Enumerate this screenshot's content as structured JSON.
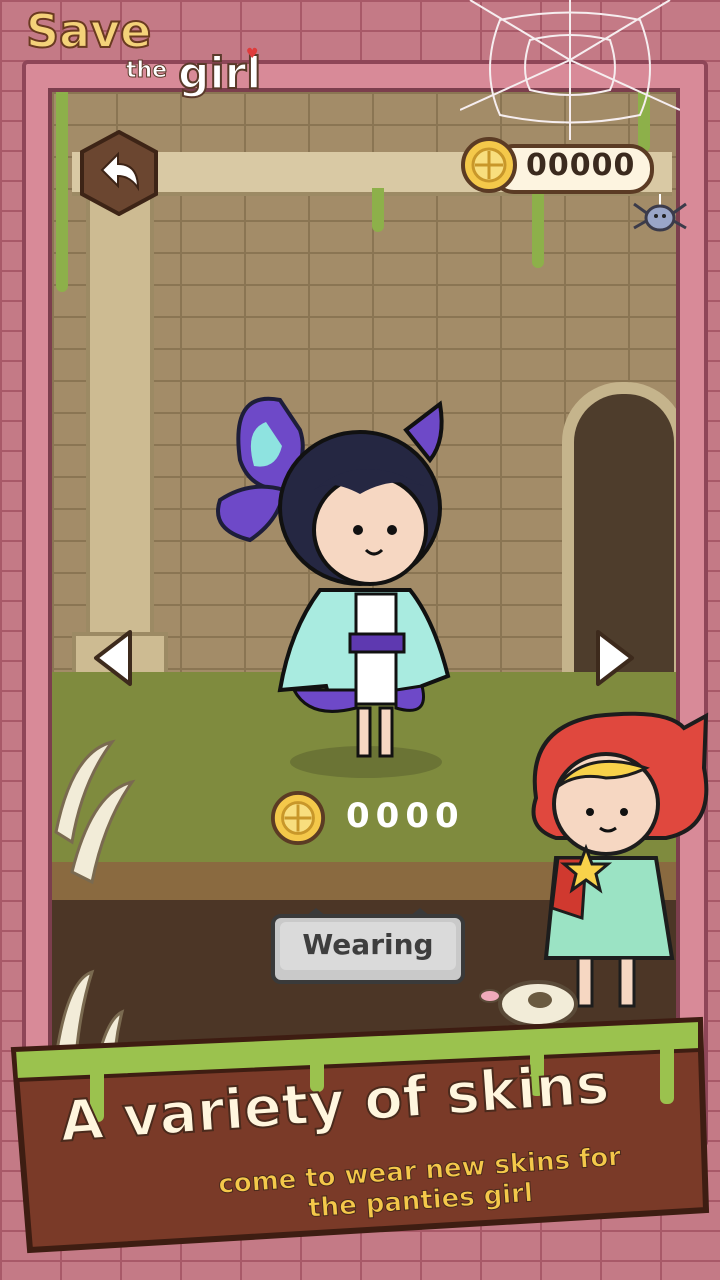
{
  "logo": {
    "line1": "Save",
    "line2": "the",
    "line3": "girl"
  },
  "header": {
    "coins": "00000"
  },
  "skin": {
    "price": "0000",
    "status_button": "Wearing"
  },
  "banner": {
    "title": "A variety of skins",
    "subtitle_line1": "come to wear new skins for",
    "subtitle_line2": "the panties girl"
  },
  "icons": {
    "back": "back-arrow-icon",
    "coin": "coin-icon",
    "prev": "chevron-left-icon",
    "next": "chevron-right-icon"
  },
  "colors": {
    "gold": "#f4c84a",
    "brick": "#c47a86",
    "button_gray": "#c9c9c9"
  }
}
